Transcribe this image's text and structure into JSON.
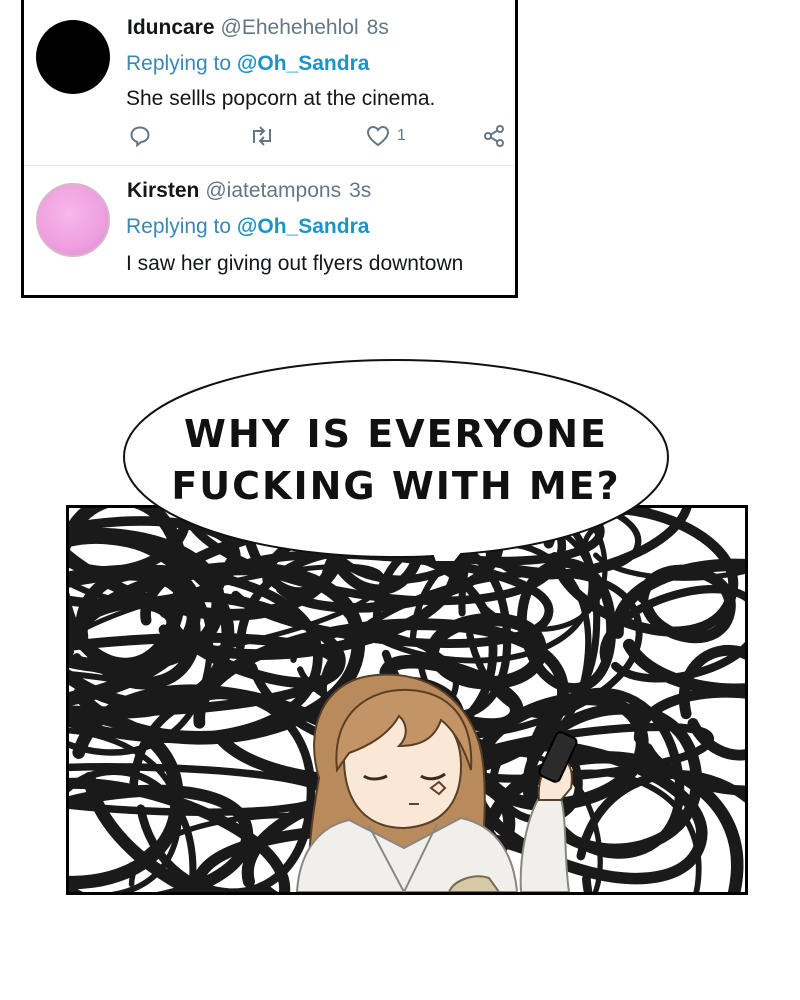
{
  "tweets": [
    {
      "name": "Iduncare",
      "handle": "@Eheheheh lol",
      "time": "8s",
      "replying_prefix": "Replying to",
      "replying_to": "@Oh_Sandra",
      "text": "She sellls popcorn at the cinema.",
      "like_count": "1",
      "avatar": "black-circle-avatar"
    },
    {
      "name": "Kirsten",
      "handle": "@iatetampons",
      "time": "3s",
      "replying_prefix": "Replying to",
      "replying_to": "@Oh_Sandra",
      "text": "I saw her giving out flyers downtown",
      "avatar": "pink-circle-avatar"
    }
  ],
  "icons": [
    "reply-icon",
    "retweet-icon",
    "heart-icon",
    "share-icon"
  ],
  "speech_bubble": {
    "line1": "WHY IS EVERYONE",
    "line2": "FUCKING WITH ME?"
  },
  "colors": {
    "link": "#1b95c9",
    "reply_label": "#3b88b5",
    "muted": "#657786",
    "avatar_pink": "#ee9fdf",
    "hair": "#b98a5c"
  }
}
